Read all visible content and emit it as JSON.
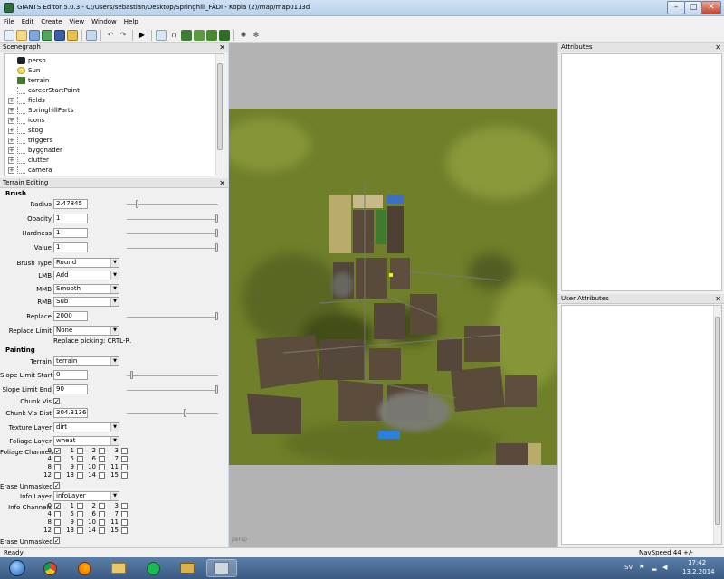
{
  "window": {
    "title": "GIANTS Editor 5.0.3 - C:/Users/sebastian/Desktop/Springhill_FÄDI - Kopia (2)/map/map01.i3d"
  },
  "menu": [
    "File",
    "Edit",
    "Create",
    "View",
    "Window",
    "Help"
  ],
  "scenegraph": {
    "title": "Scenegraph",
    "items": [
      {
        "label": "persp",
        "icon": "camera-icon"
      },
      {
        "label": "Sun",
        "icon": "light-bulb-icon"
      },
      {
        "label": "terrain",
        "icon": "terrain-icon"
      },
      {
        "label": "careerStartPoint",
        "icon": "transform-node-icon"
      },
      {
        "label": "fields",
        "icon": "transform-group-icon"
      },
      {
        "label": "SpringhillParts",
        "icon": "transform-group-icon"
      },
      {
        "label": "icons",
        "icon": "transform-group-icon"
      },
      {
        "label": "skog",
        "icon": "transform-group-icon"
      },
      {
        "label": "triggers",
        "icon": "transform-group-icon"
      },
      {
        "label": "byggnader",
        "icon": "transform-group-icon"
      },
      {
        "label": "clutter",
        "icon": "transform-group-icon"
      },
      {
        "label": "camera",
        "icon": "transform-group-icon"
      }
    ]
  },
  "terrain_editing": {
    "title": "Terrain Editing",
    "brush_header": "Brush",
    "radius_label": "Radius",
    "radius_value": "2.47845",
    "opacity_label": "Opacity",
    "opacity_value": "1",
    "hardness_label": "Hardness",
    "hardness_value": "1",
    "value_label": "Value",
    "value_value": "1",
    "brush_type_label": "Brush Type",
    "brush_type_value": "Round",
    "lmb_label": "LMB",
    "lmb_value": "Add",
    "mmb_label": "MMB",
    "mmb_value": "Smooth",
    "rmb_label": "RMB",
    "rmb_value": "Sub",
    "replace_label": "Replace",
    "replace_value": "2000",
    "replace_limit_label": "Replace Limit",
    "replace_limit_value": "None",
    "replace_picking_hint": "Replace picking: CRTL-R.",
    "painting_header": "Painting",
    "terrain_label": "Terrain",
    "terrain_value": "terrain",
    "slope_start_label": "Slope Limit Start",
    "slope_start_value": "0",
    "slope_end_label": "Slope Limit End",
    "slope_end_value": "90",
    "chunk_vis_label": "Chunk Vis",
    "chunk_vis_dist_label": "Chunk Vis Dist",
    "chunk_vis_dist_value": "304.31366",
    "texture_layer_label": "Texture Layer",
    "texture_layer_value": "dirt",
    "foliage_layer_label": "Foliage Layer",
    "foliage_layer_value": "wheat",
    "foliage_channels_label": "Foliage Channels",
    "erase_unmasked_label": "Erase Unmasked",
    "info_layer_label": "Info Layer",
    "info_layer_value": "infoLayer",
    "info_channels_label": "Info Channels",
    "channels": [
      "0",
      "1",
      "2",
      "3",
      "4",
      "5",
      "6",
      "7",
      "8",
      "9",
      "10",
      "11",
      "12",
      "13",
      "14",
      "15"
    ]
  },
  "attributes": {
    "title": "Attributes"
  },
  "user_attributes": {
    "title": "User Attributes"
  },
  "viewport": {
    "camera_label": "persp"
  },
  "status": {
    "left": "Ready",
    "navspeed": "NavSpeed 44 +/-"
  },
  "taskbar": {
    "apps": [
      "start-orb-icon",
      "ie-icon",
      "chrome-icon",
      "firefox-icon",
      "explorer-icon",
      "spotify-icon",
      "archive-icon",
      "giants-editor-icon"
    ],
    "lang": "SV",
    "time": "17:42",
    "date": "13.2.2014"
  },
  "colors": {
    "grass": "#6f7f2a",
    "field_brown": "#5a4a3a",
    "taskbar": "#3a5a82"
  }
}
